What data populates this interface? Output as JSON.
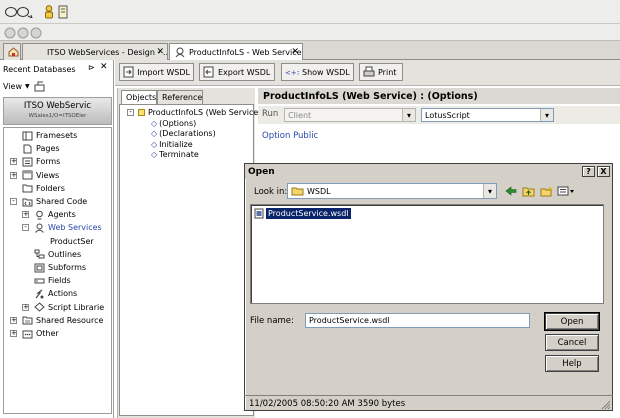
{
  "tabs": [
    {
      "label": "ITSO WebServices - Design - ...",
      "active": false
    },
    {
      "label": "ProductInfoLS - Web Service",
      "active": true
    }
  ],
  "left_panel": {
    "title": "Recent Databases",
    "view_label": "View",
    "db_name": "ITSO WebServic",
    "db_path": "WSales1/O=ITSOEler",
    "nav": [
      {
        "label": "Framesets",
        "icon": "frameset-icon",
        "indent": 0,
        "expander": ""
      },
      {
        "label": "Pages",
        "icon": "page-icon",
        "indent": 0,
        "expander": ""
      },
      {
        "label": "Forms",
        "icon": "form-icon",
        "indent": 0,
        "expander": "+"
      },
      {
        "label": "Views",
        "icon": "view-icon",
        "indent": 0,
        "expander": "+"
      },
      {
        "label": "Folders",
        "icon": "folder-icon",
        "indent": 0,
        "expander": ""
      },
      {
        "label": "Shared Code",
        "icon": "shared-code-icon",
        "indent": 0,
        "expander": "-"
      },
      {
        "label": "Agents",
        "icon": "agent-icon",
        "indent": 1,
        "expander": "+"
      },
      {
        "label": "Web Services",
        "icon": "web-service-icon",
        "indent": 1,
        "expander": "-",
        "link": true
      },
      {
        "label": "ProductSer",
        "icon": "",
        "indent": 2,
        "expander": ""
      },
      {
        "label": "Outlines",
        "icon": "outline-icon",
        "indent": 1,
        "expander": ""
      },
      {
        "label": "Subforms",
        "icon": "subform-icon",
        "indent": 1,
        "expander": ""
      },
      {
        "label": "Fields",
        "icon": "field-icon",
        "indent": 1,
        "expander": ""
      },
      {
        "label": "Actions",
        "icon": "action-icon",
        "indent": 1,
        "expander": ""
      },
      {
        "label": "Script Librarie",
        "icon": "script-library-icon",
        "indent": 1,
        "expander": "+"
      },
      {
        "label": "Shared Resource",
        "icon": "shared-resource-icon",
        "indent": 0,
        "expander": "+"
      },
      {
        "label": "Other",
        "icon": "other-icon",
        "indent": 0,
        "expander": "+"
      }
    ]
  },
  "toolbar": {
    "import": "Import WSDL",
    "export": "Export WSDL",
    "show": "Show WSDL",
    "print": "Print"
  },
  "objects": {
    "tab_objects": "Objects",
    "tab_reference": "Reference",
    "tree": [
      {
        "label": "ProductInfoLS (Web Service",
        "indent": 0
      },
      {
        "label": "(Options)",
        "indent": 1
      },
      {
        "label": "(Declarations)",
        "indent": 1
      },
      {
        "label": "Initialize",
        "indent": 1
      },
      {
        "label": "Terminate",
        "indent": 1
      }
    ]
  },
  "editor": {
    "title": "ProductInfoLS (Web Service) : (Options)",
    "run_label": "Run",
    "run_value": "Client",
    "language": "LotusScript",
    "code": "Option Public"
  },
  "dialog": {
    "title": "Open",
    "help_button": "?",
    "close_button": "X",
    "look_in_label": "Look in:",
    "look_in_value": "WSDL",
    "file": "ProductService.wsdl",
    "file_name_label": "File name:",
    "file_name_value": "ProductService.wsdl",
    "open_label": "Open",
    "cancel_label": "Cancel",
    "help_label": "Help",
    "status": "11/02/2005 08:50:20 AM  3590 bytes"
  }
}
